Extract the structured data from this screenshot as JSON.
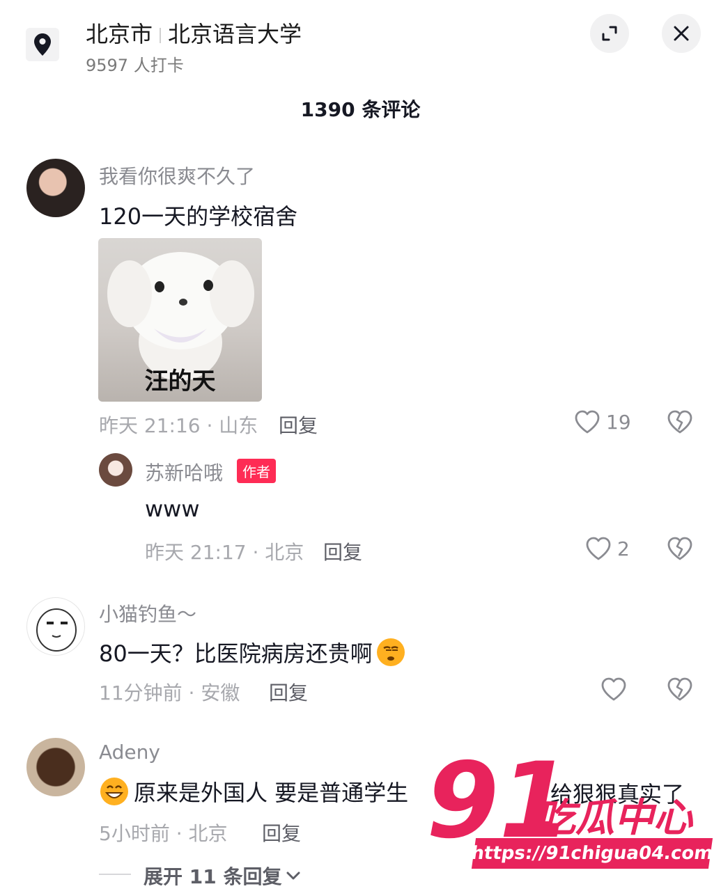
{
  "header": {
    "city": "北京市",
    "place": "北京语言大学",
    "checkins": "9597 人打卡",
    "comment_count": "1390 条评论"
  },
  "comments": [
    {
      "user": "我看你很爽不久了",
      "text": "120一天的学校宿舍",
      "sticker_caption": "汪的天",
      "meta": "昨天 21:16 · 山东",
      "reply": "回复",
      "likes": "19",
      "replies": [
        {
          "user": "苏新哈哦",
          "badge": "作者",
          "text": "www",
          "meta": "昨天 21:17 · 北京",
          "reply": "回复",
          "likes": "2"
        }
      ]
    },
    {
      "user": "小猫钓鱼～",
      "text": "80一天？比医院病房还贵啊",
      "meta": "11分钟前 · 安徽",
      "reply": "回复",
      "likes": ""
    },
    {
      "user": "Adeny",
      "text": "原来是外国人 要是普通学生",
      "text_tail": "给狠狠真实了",
      "meta": "5小时前 · 北京",
      "reply": "回复",
      "expand": "展开 11 条回复"
    }
  ],
  "watermark": {
    "big": "91",
    "name": "吃瓜中心",
    "url": "https://91chigua04.com"
  },
  "icons": [
    "location-pin-icon",
    "expand-icon",
    "close-icon",
    "heart-icon",
    "broken-heart-icon",
    "chevron-down-icon",
    "smirk-emoji-icon",
    "grin-emoji-icon"
  ],
  "colors": {
    "accent": "#fe2c55",
    "watermark": "#e8235c"
  }
}
